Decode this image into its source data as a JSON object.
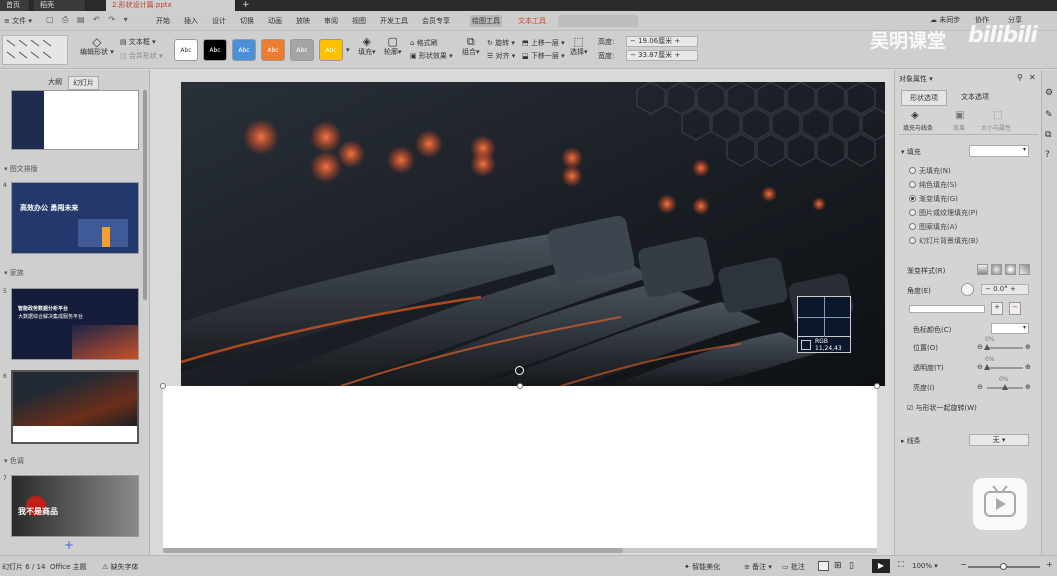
{
  "tabs": [
    {
      "label": "首页"
    },
    {
      "label": "稻壳"
    },
    {
      "label": "2.形状设计篇.pptx"
    }
  ],
  "menu": {
    "file": "文件",
    "items": [
      "开始",
      "插入",
      "设计",
      "切换",
      "动画",
      "放映",
      "审阅",
      "视图",
      "开发工具",
      "会员专享",
      "绘图工具",
      "文本工具"
    ]
  },
  "ribbon": {
    "edit_shape": "编辑形状",
    "textbox": "文本框",
    "merge_shape": "合并形状",
    "style_swatches": [
      "Abc",
      "Abc",
      "Abc",
      "Abc",
      "Abc",
      "Abc"
    ],
    "swatch_colors": [
      "#ffffff",
      "#000000",
      "#4a90d9",
      "#ed7d31",
      "#a5a5a5",
      "#ffc000"
    ],
    "fill": "填充",
    "outline": "轮廓",
    "format_painter": "格式刷",
    "shape_effect": "形状效果",
    "rotate": "旋转",
    "align": "对齐",
    "group": "组合",
    "bring_forward": "上移一层",
    "send_backward": "下移一层",
    "select": "选择",
    "height_label": "高度:",
    "height_value": "19.06厘米",
    "width_label": "宽度:",
    "width_value": "33.87厘米"
  },
  "topright": {
    "sync": "未同步",
    "collab": "协作",
    "share": "分享"
  },
  "left_panel": {
    "tab_outline": "大纲",
    "tab_slides": "幻灯片",
    "sections": [
      "图文排版",
      "家族",
      "色调"
    ],
    "slide_numbers": [
      "4",
      "5",
      "6",
      "7"
    ],
    "thumb2_title": "高效办公 勇闯未来",
    "thumb3_title": "智能政务数据分析平台",
    "thumb3_sub": "大数据综合解决集成服务平台",
    "thumb5_text": "我不是商品",
    "add_slide": "+"
  },
  "color_picker": {
    "label": "RGB",
    "value": "11,24,43"
  },
  "right_panel": {
    "title": "对象属性",
    "tab_shape": "形状选项",
    "tab_text": "文本选项",
    "sub_fill_line": "填充与线条",
    "sub_effect": "效果",
    "sub_size": "大小与属性",
    "fill_section": "填充",
    "fill_options": [
      "无填充(N)",
      "纯色填充(S)",
      "渐变填充(G)",
      "图片或纹理填充(P)",
      "图案填充(A)",
      "幻灯片背景填充(B)"
    ],
    "selected_fill": 2,
    "gradient_style": "渐变样式(R)",
    "angle": "角度(E)",
    "angle_value": "0.0°",
    "stop_color": "色标颜色(C)",
    "position": "位置(O)",
    "position_value": "0%",
    "transparency": "透明度(T)",
    "transparency_value": "0%",
    "brightness": "亮度(I)",
    "brightness_value": "0%",
    "rotate_with_shape": "与形状一起旋转(W)",
    "line_section": "线条",
    "line_value": "无"
  },
  "statusbar": {
    "slide_pos": "幻灯片 6 / 14",
    "theme": "Office 主题",
    "missing_font": "缺失字体",
    "smart_beautify": "智能美化",
    "notes": "备注",
    "comments": "批注",
    "zoom": "100%"
  },
  "watermark": {
    "channel": "吴明课堂",
    "site": "bilibili"
  }
}
